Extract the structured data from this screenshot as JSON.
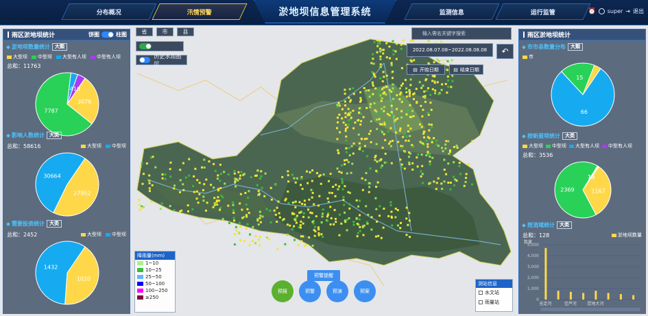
{
  "header": {
    "title": "淤地坝信息管理系统",
    "tabs": [
      {
        "label": "分布概况",
        "active": false
      },
      {
        "label": "汛情预警",
        "active": true
      },
      {
        "label": "监测信息",
        "active": false
      },
      {
        "label": "运行监管",
        "active": false
      }
    ],
    "username": "super",
    "logout_label": "退出"
  },
  "left_panel": {
    "title": "雨区淤地坝统计",
    "toggle_left": "饼图",
    "toggle_right": "柱图",
    "sections": [
      {
        "title": "淤地坝数量统计",
        "badge": "大類",
        "legend": [
          {
            "label": "大型坝",
            "color": "#ffd84a"
          },
          {
            "label": "中型坝",
            "color": "#29d158"
          },
          {
            "label": "大型有人坝",
            "color": "#16aaf0"
          },
          {
            "label": "中型有人坝",
            "color": "#a93cf0"
          }
        ],
        "total": "总和：11763"
      },
      {
        "title": "影响人数统计",
        "badge": "大类",
        "legend": [
          {
            "label": "大型坝",
            "color": "#ffd84a"
          },
          {
            "label": "中型坝",
            "color": "#16aaf0"
          }
        ],
        "total": "总和：58616"
      },
      {
        "title": "需要投资统计",
        "badge": "大类",
        "legend": [
          {
            "label": "大型坝",
            "color": "#ffd84a"
          },
          {
            "label": "中型坝",
            "color": "#16aaf0"
          }
        ],
        "total": "总和：2452"
      }
    ]
  },
  "right_panel": {
    "title": "雨区淤地坝统计",
    "sections": [
      {
        "title": "市市县数量分布",
        "badge": "大類",
        "legend": [
          {
            "label": "市",
            "color": "#ffd84a"
          }
        ]
      },
      {
        "title": "按新报坝统计",
        "badge": "大类",
        "legend": [
          {
            "label": "大型坝",
            "color": "#ffd84a"
          },
          {
            "label": "中型坝",
            "color": "#29d158"
          },
          {
            "label": "大型有人坝",
            "color": "#16aaf0"
          },
          {
            "label": "中型有人坝",
            "color": "#a93cf0"
          }
        ],
        "total": "总和：3536"
      },
      {
        "title": "按流域统计",
        "badge": "大类",
        "total": "总和：128",
        "legend": [
          {
            "label": "淤地坝数量",
            "color": "#ffd84a"
          }
        ]
      }
    ]
  },
  "map_controls": {
    "level_buttons": [
      "省",
      "市",
      "县"
    ],
    "switch_1_label": "",
    "switch_2_label": "历史水雨图层",
    "search_placeholder": "输入需名关键字搜索",
    "date_range": "2022.08.07.08~2022.08.08.08",
    "start_date_label": "开始日期",
    "end_date_label": "结束日期"
  },
  "rain_legend": {
    "title": "降雨量(mm)",
    "items": [
      {
        "label": "1~10",
        "color": "#a6f28f"
      },
      {
        "label": "10~25",
        "color": "#3dba3d"
      },
      {
        "label": "25~50",
        "color": "#61b8ff"
      },
      {
        "label": "50~100",
        "color": "#0000fe"
      },
      {
        "label": "100~250",
        "color": "#fa00fa"
      },
      {
        "label": "≥250",
        "color": "#800040"
      }
    ]
  },
  "bottom": {
    "alert_button": "预警提醒",
    "circle_buttons": [
      {
        "label": "预报",
        "color": "#5cb030"
      },
      {
        "label": "预警",
        "color": "#3c8ff0"
      },
      {
        "label": "预演",
        "color": "#3c8ff0"
      },
      {
        "label": "预案",
        "color": "#3c8ff0"
      }
    ]
  },
  "station_legend": {
    "title": "测站信息",
    "items": [
      "水文站",
      "雨量站"
    ]
  },
  "chart_data": [
    {
      "type": "pie",
      "title": "淤地坝数量统计",
      "labels": [
        "大型坝",
        "中型坝",
        "大型有人坝",
        "中型有人坝"
      ],
      "values": [
        3076,
        7787,
        416,
        484
      ],
      "printed_labels": [
        "3076",
        "7787",
        "",
        "416"
      ],
      "colors": [
        "#ffd84a",
        "#29d158",
        "#16aaf0",
        "#a93cf0"
      ]
    },
    {
      "type": "pie",
      "title": "影响人数统计",
      "labels": [
        "大型坝",
        "中型坝"
      ],
      "values": [
        27952,
        30664
      ],
      "colors": [
        "#ffd84a",
        "#16aaf0"
      ]
    },
    {
      "type": "pie",
      "title": "需要投资统计",
      "labels": [
        "大型坝",
        "中型坝"
      ],
      "values": [
        1020,
        1432
      ],
      "colors": [
        "#ffd84a",
        "#16aaf0"
      ]
    },
    {
      "type": "pie",
      "title": "市市县数量分布",
      "labels": [
        "",
        "",
        ""
      ],
      "values": [
        66,
        15,
        3
      ],
      "printed_labels": [
        "66",
        "15",
        ""
      ],
      "colors": [
        "#16aaf0",
        "#29d158",
        "#ffd84a"
      ]
    },
    {
      "type": "pie",
      "title": "按新报坝统计",
      "labels": [
        "大型坝",
        "中型坝",
        "大型有人坝",
        "中型有人坝"
      ],
      "values": [
        1167,
        2369,
        15,
        15
      ],
      "printed_labels": [
        "1167",
        "2369",
        "15",
        "15"
      ],
      "colors": [
        "#ffd84a",
        "#29d158",
        "#16aaf0",
        "#a93cf0"
      ]
    },
    {
      "type": "bar",
      "title": "按流域统计",
      "categories": [
        "无定河",
        "",
        "佳芦河",
        "",
        "昆地大河",
        "",
        "",
        ""
      ],
      "values": [
        4700,
        800,
        700,
        600,
        800,
        600,
        500,
        400
      ],
      "ylim": [
        0,
        5000
      ],
      "yticks": [
        "0",
        "1,000",
        "2,000",
        "3,000",
        "4,000",
        "5,000"
      ],
      "ylabel": "数量",
      "series_name": "淤地坝数量"
    }
  ]
}
